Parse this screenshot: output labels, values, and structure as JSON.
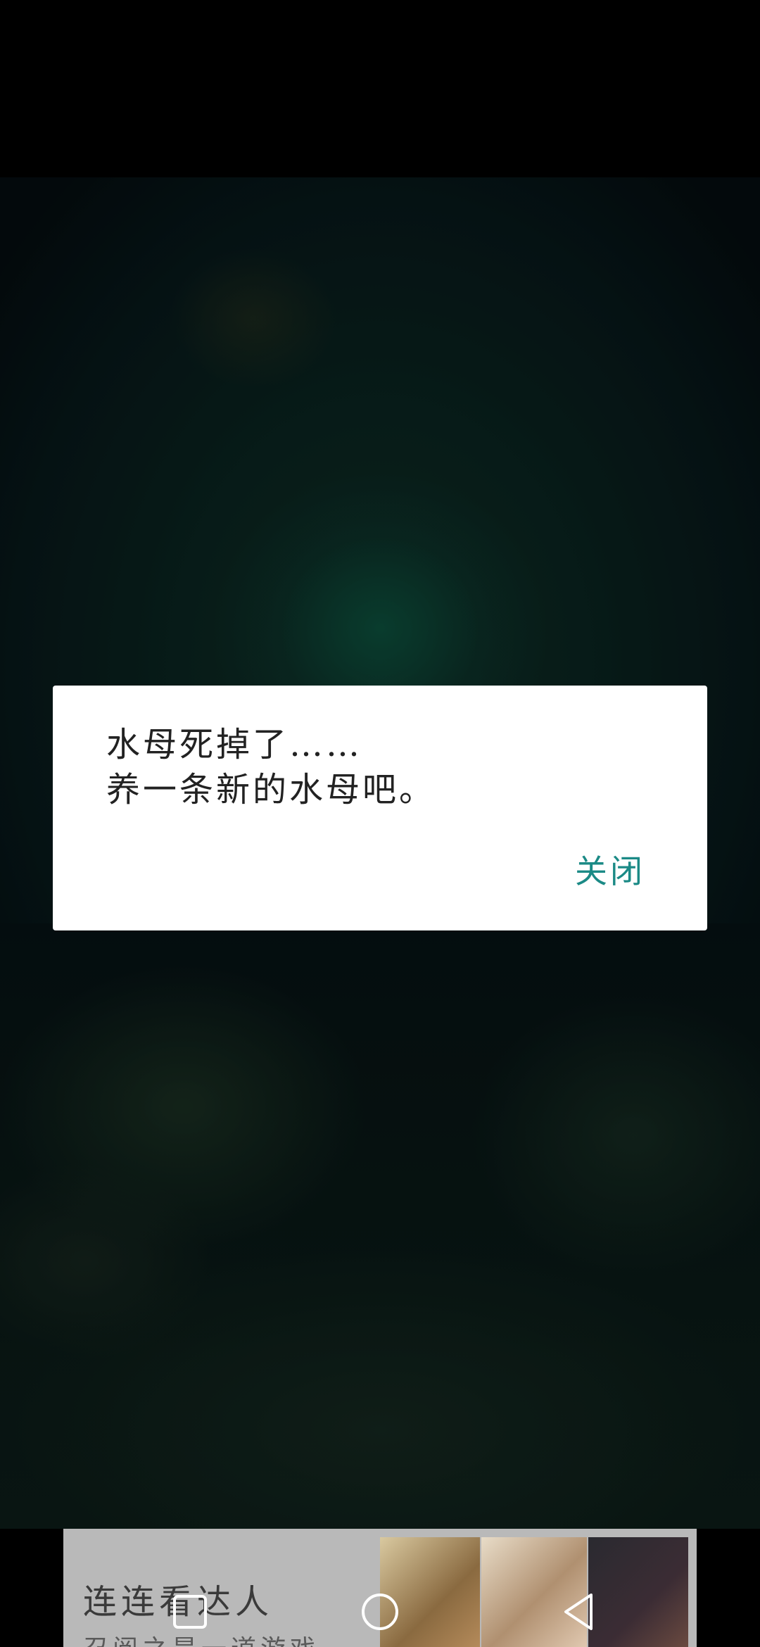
{
  "dialog": {
    "message_lines": [
      "水母死掉了……",
      "养一条新的水母吧。"
    ],
    "close_label": "关闭",
    "accent_color": "#1b8a86"
  },
  "ad": {
    "title": "连连看达人",
    "subtitle": "召阅之是一道游戏"
  },
  "nav": {
    "icons": [
      "recent-apps-icon",
      "home-icon",
      "back-icon"
    ]
  }
}
